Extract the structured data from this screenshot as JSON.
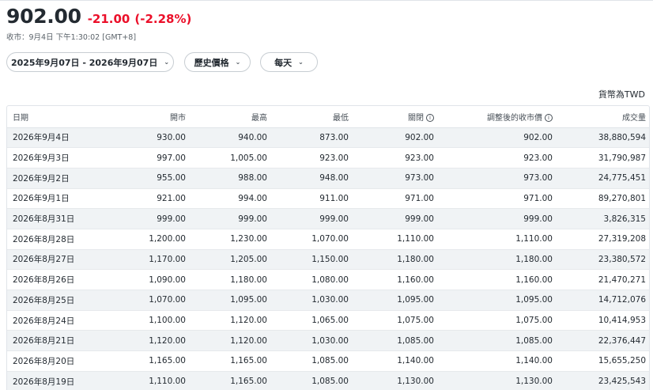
{
  "quote": {
    "price": "902.00",
    "change": "-21.00",
    "change_pct": "(-2.28%)",
    "market_time": "收市：9月4日 下午1:30:02 [GMT+8]",
    "change_color": "#eb0f29"
  },
  "filters": {
    "date_range": "2025年9月07日 - 2026年9月07日",
    "data_type": "歷史價格",
    "frequency": "每天"
  },
  "currency_note": "貨幣為TWD",
  "table": {
    "headers": [
      "日期",
      "開市",
      "最高",
      "最低",
      "關閉",
      "調整後的收市價",
      "成交量"
    ],
    "rows": [
      [
        "2026年9月4日",
        "930.00",
        "940.00",
        "873.00",
        "902.00",
        "902.00",
        "38,880,594"
      ],
      [
        "2026年9月3日",
        "997.00",
        "1,005.00",
        "923.00",
        "923.00",
        "923.00",
        "31,790,987"
      ],
      [
        "2026年9月2日",
        "955.00",
        "988.00",
        "948.00",
        "973.00",
        "973.00",
        "24,775,451"
      ],
      [
        "2026年9月1日",
        "921.00",
        "994.00",
        "911.00",
        "971.00",
        "971.00",
        "89,270,801"
      ],
      [
        "2026年8月31日",
        "999.00",
        "999.00",
        "999.00",
        "999.00",
        "999.00",
        "3,826,315"
      ],
      [
        "2026年8月28日",
        "1,200.00",
        "1,230.00",
        "1,070.00",
        "1,110.00",
        "1,110.00",
        "27,319,208"
      ],
      [
        "2026年8月27日",
        "1,170.00",
        "1,205.00",
        "1,150.00",
        "1,180.00",
        "1,180.00",
        "23,380,572"
      ],
      [
        "2026年8月26日",
        "1,090.00",
        "1,180.00",
        "1,080.00",
        "1,160.00",
        "1,160.00",
        "21,470,271"
      ],
      [
        "2026年8月25日",
        "1,070.00",
        "1,095.00",
        "1,030.00",
        "1,095.00",
        "1,095.00",
        "14,712,076"
      ],
      [
        "2026年8月24日",
        "1,100.00",
        "1,120.00",
        "1,065.00",
        "1,075.00",
        "1,075.00",
        "10,414,953"
      ],
      [
        "2026年8月21日",
        "1,120.00",
        "1,120.00",
        "1,030.00",
        "1,085.00",
        "1,085.00",
        "22,376,447"
      ],
      [
        "2026年8月20日",
        "1,165.00",
        "1,165.00",
        "1,085.00",
        "1,140.00",
        "1,140.00",
        "15,655,250"
      ],
      [
        "2026年8月19日",
        "1,110.00",
        "1,165.00",
        "1,085.00",
        "1,130.00",
        "1,130.00",
        "23,425,543"
      ]
    ]
  },
  "icons": {
    "chevron": "chevron-down-icon",
    "info": "info-icon"
  }
}
